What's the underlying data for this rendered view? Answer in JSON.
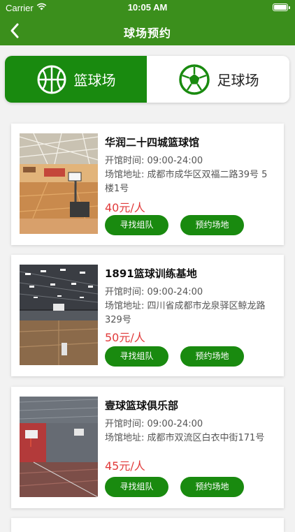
{
  "status_bar": {
    "carrier": "Carrier",
    "time": "10:05 AM"
  },
  "header": {
    "title": "球场预约"
  },
  "tabs": [
    {
      "label": "篮球场",
      "active": true,
      "icon": "basketball-icon"
    },
    {
      "label": "足球场",
      "active": false,
      "icon": "soccer-ball-icon"
    }
  ],
  "colors": {
    "brand_green": "#198a0f",
    "header_green": "#3b8f1c",
    "price_red": "#e13a3a"
  },
  "venues": [
    {
      "name": "华润二十四城篮球馆",
      "hours": "开馆时间: 09:00-24:00",
      "address": "场馆地址: 成都市成华区双福二路39号 5楼1号",
      "price": "40元/人",
      "find_team": "寻找组队",
      "book": "预约场地"
    },
    {
      "name": "1891篮球训练基地",
      "hours": "开馆时间: 09:00-24:00",
      "address": "场馆地址: 四川省成都市龙泉驿区鲸龙路329号",
      "price": "50元/人",
      "find_team": "寻找组队",
      "book": "预约场地"
    },
    {
      "name": "壹球篮球俱乐部",
      "hours": "开馆时间: 09:00-24:00",
      "address": "场馆地址: 成都市双流区白衣中街171号",
      "price": "45元/人",
      "find_team": "寻找组队",
      "book": "预约场地"
    }
  ]
}
